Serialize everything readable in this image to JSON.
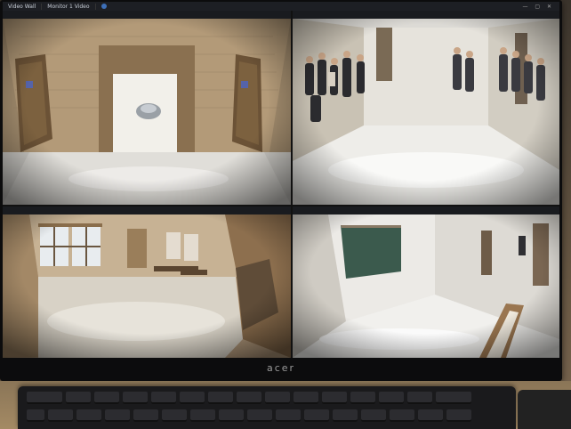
{
  "topbar": {
    "tab_label": "Video Wall",
    "tab2_label": "Monitor 1 Video",
    "notice": "",
    "window_controls": "— ▢ ✕"
  },
  "cameras": [
    {
      "caption": ""
    },
    {
      "caption": ""
    },
    {
      "caption": ""
    },
    {
      "caption": ""
    }
  ],
  "monitor": {
    "brand": "acer"
  }
}
